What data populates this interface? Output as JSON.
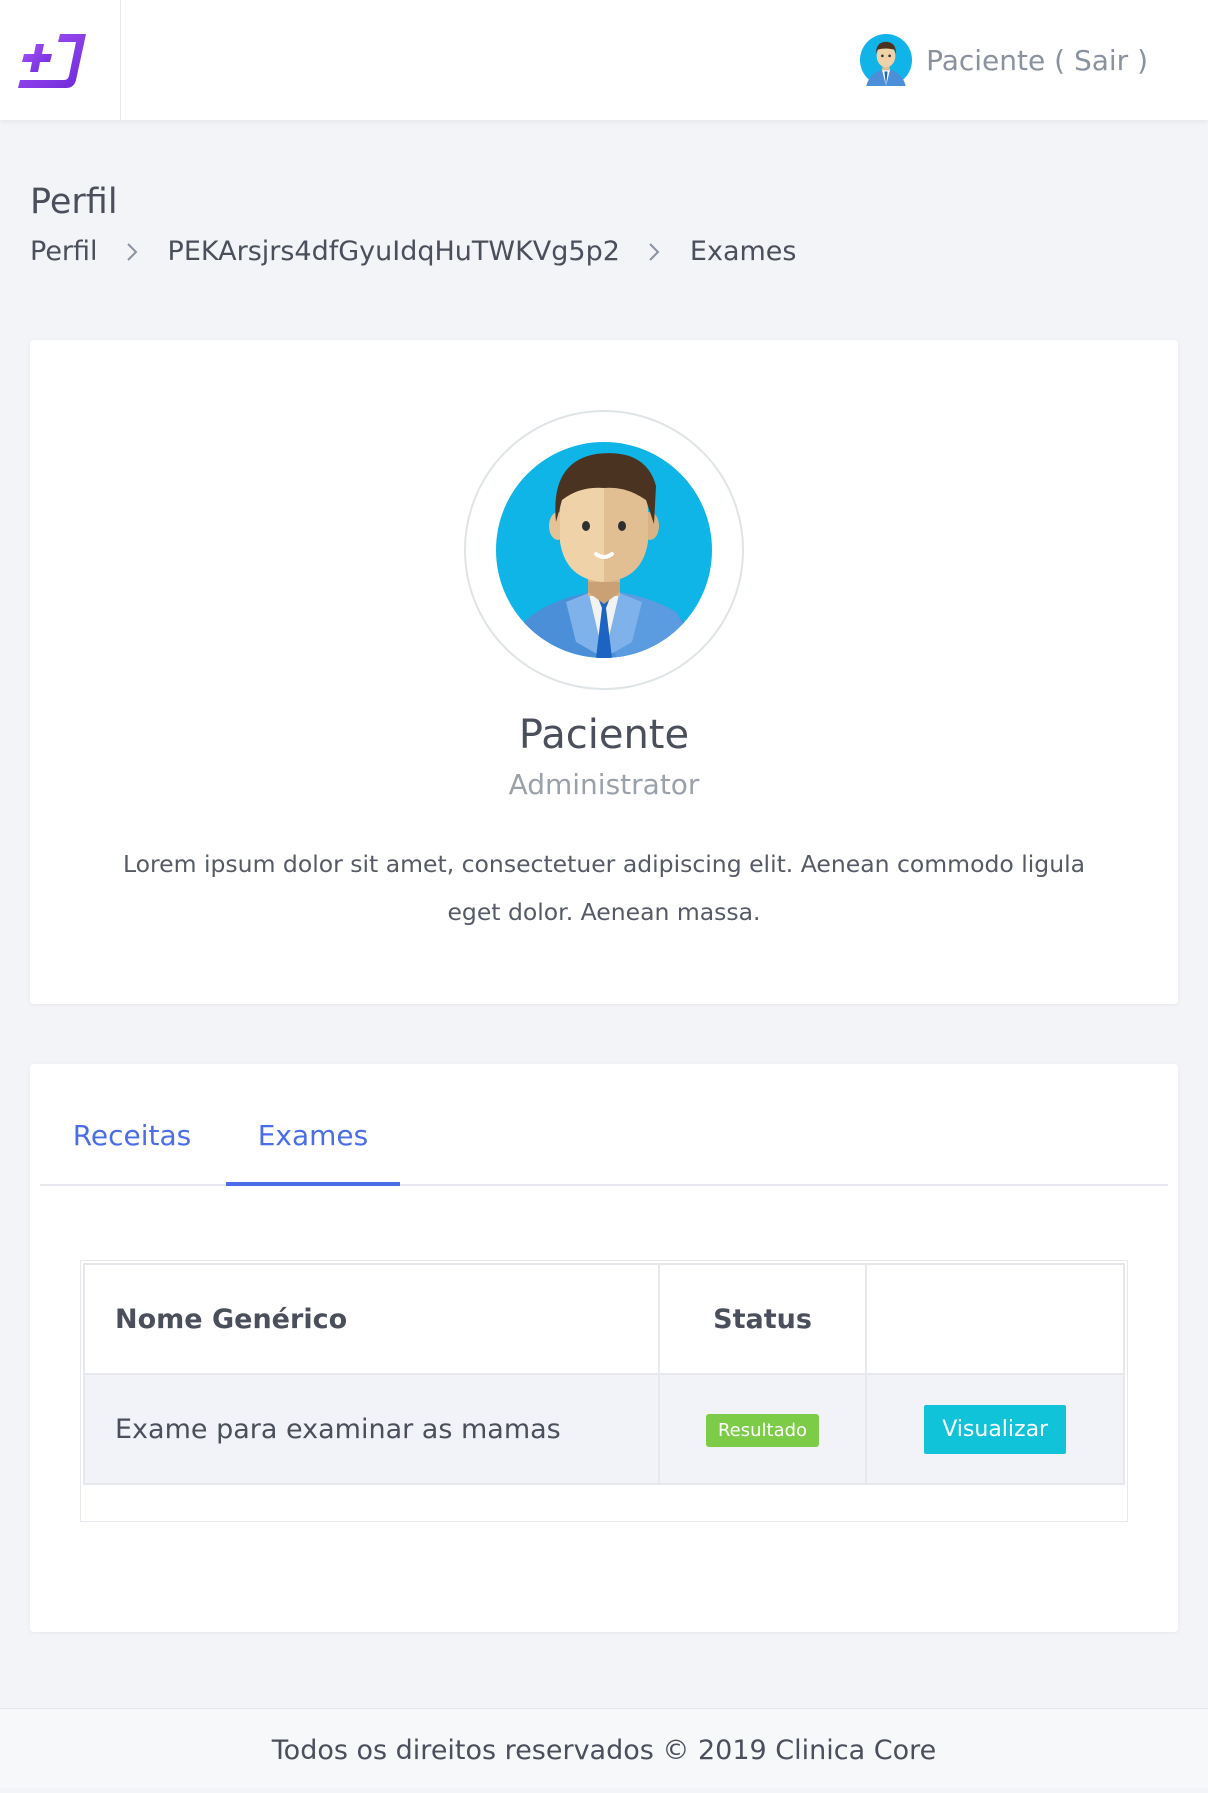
{
  "header": {
    "user_label": "Paciente ( Sair )"
  },
  "page": {
    "title": "Perfil",
    "breadcrumb": [
      "Perfil",
      "PEKArsjrs4dfGyuIdqHuTWKVg5p2",
      "Exames"
    ]
  },
  "profile": {
    "name": "Paciente",
    "role": "Administrator",
    "bio": "Lorem ipsum dolor sit amet, consectetuer adipiscing elit. Aenean commodo ligula eget dolor. Aenean massa."
  },
  "tabs": [
    {
      "label": "Receitas",
      "active": false
    },
    {
      "label": "Exames",
      "active": true
    }
  ],
  "table": {
    "headers": [
      "Nome Genérico",
      "Status",
      ""
    ],
    "rows": [
      {
        "name": "Exame para examinar as mamas",
        "status": "Resultado",
        "action": "Visualizar"
      }
    ]
  },
  "footer": {
    "text": "Todos os direitos reservados © 2019 Clinica Core"
  },
  "colors": {
    "accent": "#4b6ee8",
    "logo": "#7c3aed",
    "status_green": "#7ccc47",
    "button_cyan": "#10c3d9"
  },
  "icons": [
    "logo-icon",
    "user-avatar-icon",
    "chevron-right-icon"
  ]
}
